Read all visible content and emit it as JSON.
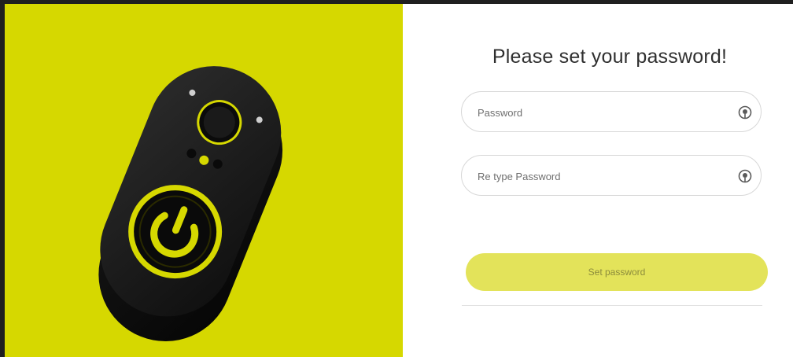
{
  "form": {
    "title": "Please set your password!",
    "password_placeholder": "Password",
    "password_value": "",
    "retype_placeholder": "Re type Password",
    "retype_value": "",
    "submit_label": "Set password"
  },
  "icons": {
    "password_toggle": "eye-icon",
    "retype_toggle": "eye-icon"
  },
  "colors": {
    "brand_yellow": "#d6d800",
    "button_bg": "#e3e35a",
    "button_text": "#8c8c3c"
  }
}
